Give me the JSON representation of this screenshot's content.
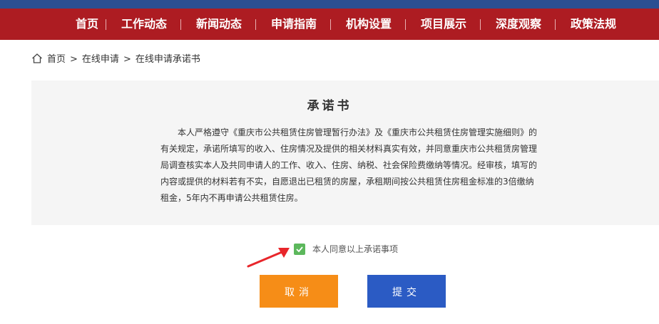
{
  "nav": {
    "items": [
      "首页",
      "工作动态",
      "新闻动态",
      "申请指南",
      "机构设置",
      "项目展示",
      "深度观察",
      "政策法规"
    ]
  },
  "breadcrumb": {
    "home": "首页",
    "level1": "在线申请",
    "level2": "在线申请承诺书",
    "separator": ">"
  },
  "pledge": {
    "title": "承诺书",
    "body": "本人严格遵守《重庆市公共租赁住房管理暂行办法》及《重庆市公共租赁住房管理实施细则》的有关规定，承诺所填写的收入、住房情况及提供的相关材料真实有效，并同意重庆市公共租赁房管理局调查核实本人及共同申请人的工作、收入、住房、纳税、社会保险费缴纳等情况。经审核，填写的内容或提供的材料若有不实，自愿退出已租赁的房屋，承租期间按公共租赁住房租金标准的3倍缴纳租金，5年内不再申请公共租赁住房。"
  },
  "agree": {
    "label": "本人同意以上承诺事项",
    "checked": true
  },
  "buttons": {
    "cancel": "取消",
    "submit": "提交"
  },
  "colors": {
    "nav_bg": "#ad1c22",
    "cancel_bg": "#f68d17",
    "submit_bg": "#2b5bc4",
    "checkbox": "#5cb85c",
    "arrow": "#e8262b"
  }
}
